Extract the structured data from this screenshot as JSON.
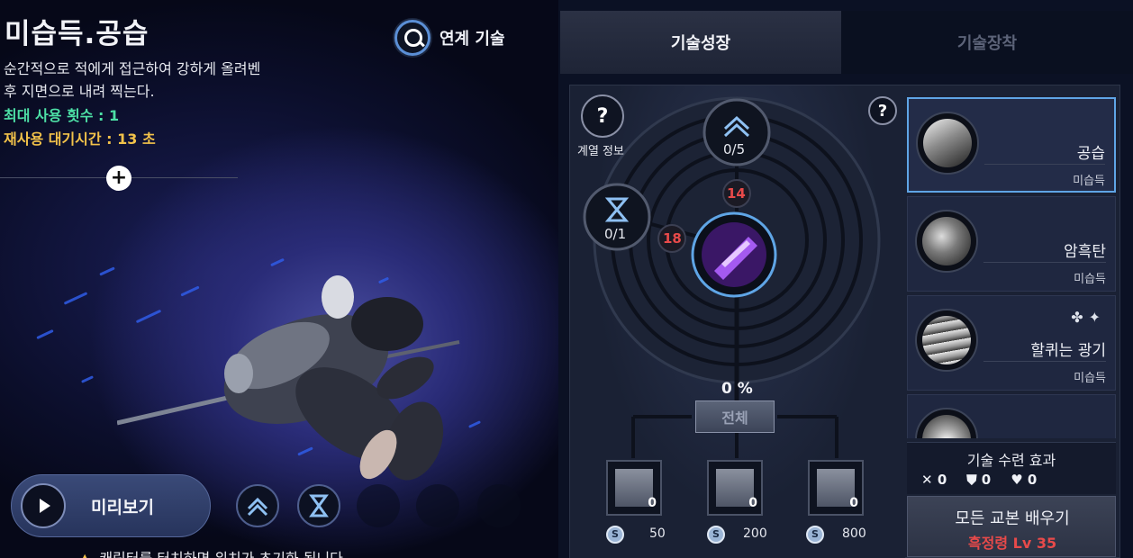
{
  "skill": {
    "title": "미습득.공습",
    "description": "순간적으로 적에게 접근하여 강하게 올려벤 후 지면으로 내려 찍는다.",
    "max_uses": "최대 사용 횟수 : 1",
    "cooldown": "재사용 대기시간 : 13 초",
    "plus_label": "+"
  },
  "link_skill": {
    "label": "연계 기술",
    "icon": "search-icon"
  },
  "preview": {
    "label": "미리보기",
    "icon": "play-icon"
  },
  "warning": {
    "icon": "warning-icon",
    "text": "캐릭터를 터치하면 위치가 초기화 됩니다"
  },
  "tabs": [
    {
      "label": "기술성장",
      "active": true
    },
    {
      "label": "기술장착",
      "active": false
    }
  ],
  "tree": {
    "series_help": "?",
    "series_label": "계열 정보",
    "help": "?",
    "top_node": {
      "icon": "chevron-up-icon",
      "value": "0/5",
      "badge": "14"
    },
    "left_node": {
      "icon": "hourglass-icon",
      "value": "0/1",
      "badge": "18"
    },
    "center_icon": "skill-attack-icon",
    "percent": "0 %",
    "all_label": "전체",
    "books": [
      {
        "count": "0",
        "cost": "50"
      },
      {
        "count": "0",
        "cost": "200"
      },
      {
        "count": "0",
        "cost": "800"
      }
    ],
    "coin_symbol": "S"
  },
  "skills": [
    {
      "name": "공습",
      "status": "미습득",
      "selected": true,
      "icon": "skill-strike-icon"
    },
    {
      "name": "암흑탄",
      "status": "미습득",
      "selected": false,
      "icon": "skill-dark-hand-icon"
    },
    {
      "name": "할퀴는 광기",
      "status": "미습득",
      "selected": false,
      "icon": "skill-claw-icon",
      "runes": "✤✦"
    },
    {
      "name": "",
      "status": "",
      "selected": false,
      "icon": "skill-burst-icon"
    }
  ],
  "training": {
    "title": "기술 수련 효과",
    "attack": "0",
    "defense": "0",
    "health": "0"
  },
  "learn": {
    "label": "모든 교본 배우기",
    "requirement": "흑정령 Lv 35"
  },
  "colors": {
    "green_stat": "#4de0a6",
    "yellow_stat": "#f2c24a",
    "badge_red": "#e84a4a",
    "selected_border": "#5fa5e6"
  }
}
